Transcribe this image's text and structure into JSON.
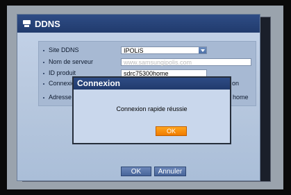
{
  "window": {
    "title": "DDNS"
  },
  "settings": {
    "rows": [
      {
        "label": "Site DDNS",
        "value": "IPOLiS"
      },
      {
        "label": "Nom de serveur",
        "placeholder": "www.samsungipolis.com"
      },
      {
        "label": "ID produit",
        "value": "sdrc75300home"
      },
      {
        "label": "Connexion rapide",
        "value": "on"
      },
      {
        "label": "Adresse",
        "value": "home"
      }
    ]
  },
  "buttons": {
    "ok": "OK",
    "cancel": "Annuler"
  },
  "modal": {
    "title": "Connexion",
    "message": "Connexion rapide réussie",
    "ok": "OK"
  },
  "icons": {
    "title_icon": "monitor-icon",
    "dropdown": "chevron-down-icon"
  },
  "colors": {
    "accent_orange": "#f59000",
    "title_blue": "#213b6d"
  }
}
